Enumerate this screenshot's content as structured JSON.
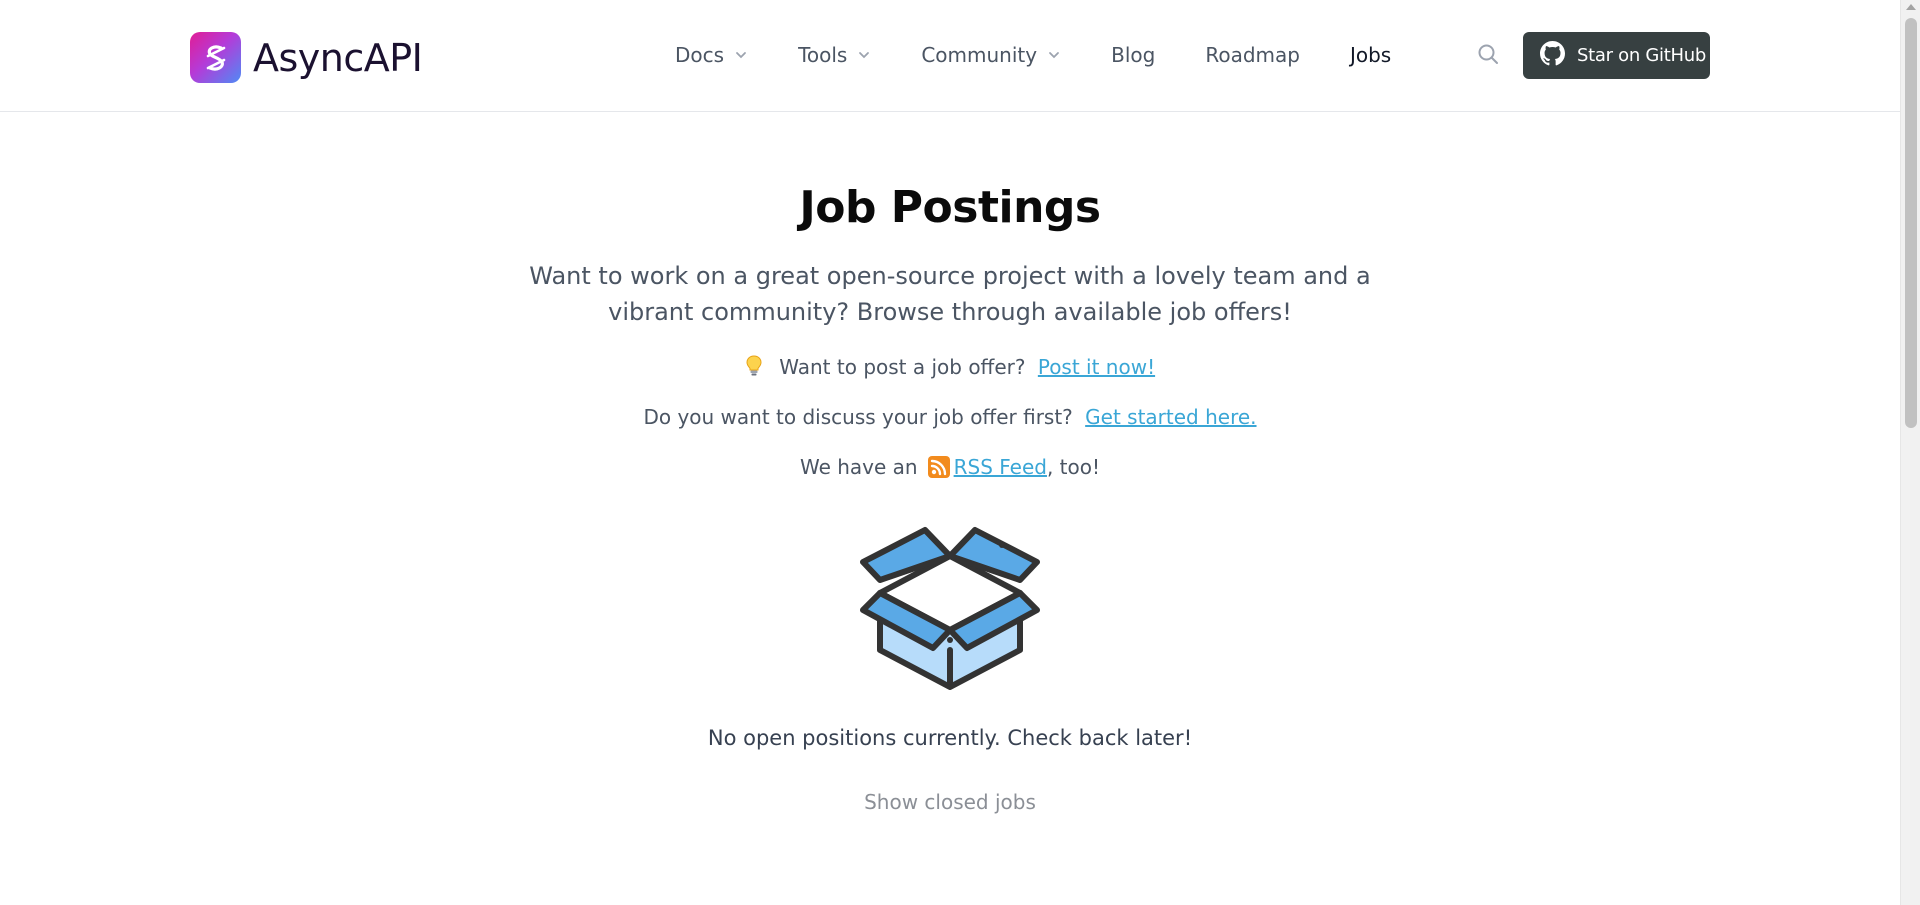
{
  "header": {
    "brand": "AsyncAPI",
    "nav": [
      {
        "label": "Docs",
        "has_dropdown": true,
        "icon": "chevron-down-icon"
      },
      {
        "label": "Tools",
        "has_dropdown": true,
        "icon": "chevron-down-icon"
      },
      {
        "label": "Community",
        "has_dropdown": true,
        "icon": "chevron-down-icon"
      },
      {
        "label": "Blog",
        "has_dropdown": false
      },
      {
        "label": "Roadmap",
        "has_dropdown": false
      },
      {
        "label": "Jobs",
        "has_dropdown": false,
        "active": true
      }
    ],
    "search_icon": "search-icon",
    "github_button": {
      "label": "Star on GitHub",
      "icon": "github-icon"
    }
  },
  "main": {
    "title": "Job Postings",
    "subtitle": "Want to work on a great open-source project with a lovely team and a vibrant community? Browse through available job offers!",
    "post_offer": {
      "icon": "lightbulb-icon",
      "text": "Want to post a job offer?",
      "link": "Post it now!"
    },
    "discuss": {
      "text": "Do you want to discuss your job offer first?",
      "link": "Get started here."
    },
    "rss": {
      "prefix": "We have an",
      "icon": "rss-icon",
      "link": "RSS Feed",
      "suffix": ", too!"
    },
    "empty_state": {
      "illustration": "open-box-icon",
      "message": "No open positions currently. Check back later!"
    },
    "show_closed": "Show closed jobs"
  },
  "colors": {
    "link": "#3aa6d6",
    "github_button_bg": "#374041",
    "text_muted": "#4b5563",
    "box_dark_blue": "#5aa9e6",
    "box_light_blue": "#b7dcfa",
    "rss_orange": "#f28b1d"
  }
}
